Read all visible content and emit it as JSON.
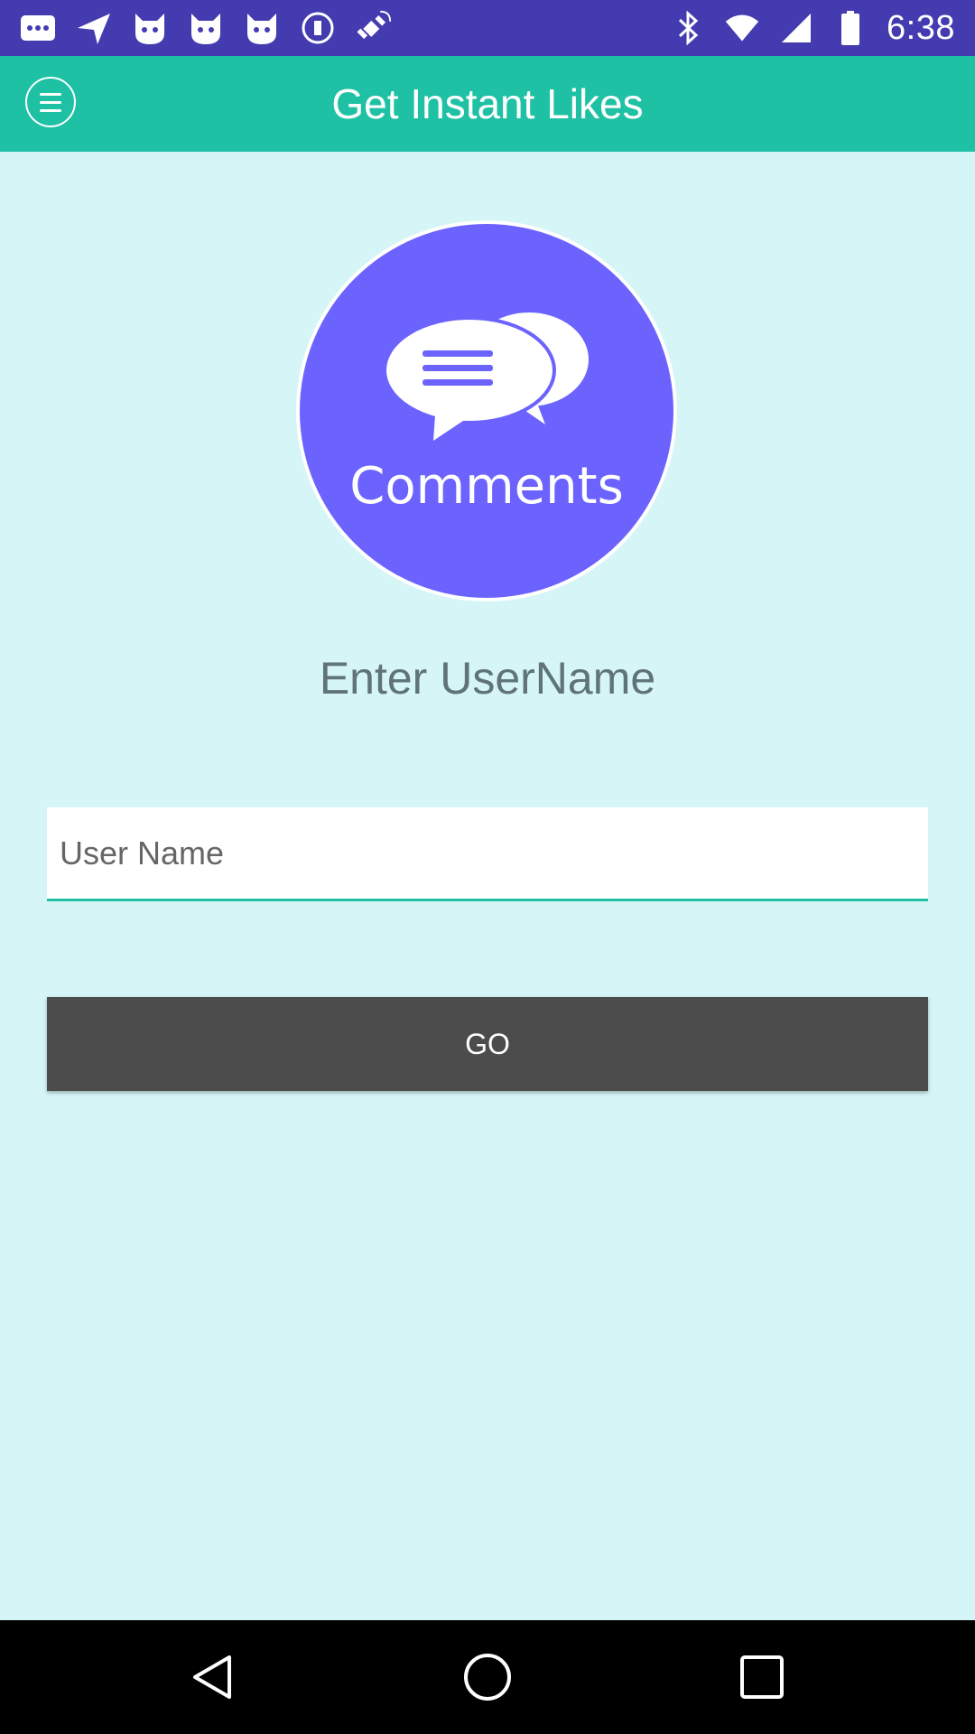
{
  "status_bar": {
    "time": "6:38",
    "left_icons": [
      "more-dots-icon",
      "navigation-arrow-icon",
      "cat-face-icon",
      "cat-face-icon",
      "cat-face-icon",
      "circle-stop-icon",
      "fake-gps-satellite-icon"
    ],
    "right_icons": [
      "bluetooth-icon",
      "wifi-icon",
      "signal-icon",
      "battery-icon"
    ]
  },
  "app_bar": {
    "title": "Get Instant Likes",
    "background_color": "#1ec1a4"
  },
  "logo": {
    "label": "Comments",
    "color": "#6c63fe"
  },
  "form": {
    "heading": "Enter UserName",
    "username_placeholder": "User Name",
    "username_value": "",
    "go_label": "GO"
  },
  "nav_bar": {
    "buttons": [
      "back-icon",
      "home-icon",
      "recents-icon"
    ]
  }
}
